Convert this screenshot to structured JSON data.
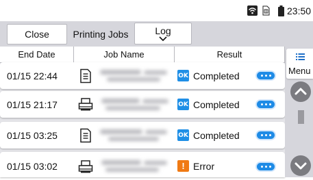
{
  "status_bar": {
    "time": "23:50"
  },
  "toolbar": {
    "close_label": "Close",
    "printing_jobs_label": "Printing Jobs",
    "log_label": "Log"
  },
  "table": {
    "columns": [
      "End Date",
      "Job Name",
      "Result"
    ],
    "rows": [
      {
        "end_date": "01/15 22:44",
        "job_icon": "document-icon",
        "result": "Completed",
        "result_icon": "ok-icon",
        "result_icon_text": "OK"
      },
      {
        "end_date": "01/15 21:17",
        "job_icon": "printer-icon",
        "result": "Completed",
        "result_icon": "ok-icon",
        "result_icon_text": "OK"
      },
      {
        "end_date": "01/15 03:25",
        "job_icon": "document-icon",
        "result": "Completed",
        "result_icon": "ok-icon",
        "result_icon_text": "OK"
      },
      {
        "end_date": "01/15 03:02",
        "job_icon": "printer-icon",
        "result": "Error",
        "result_icon": "error-icon",
        "result_icon_text": "!"
      }
    ]
  },
  "side": {
    "menu_label": "Menu"
  },
  "colors": {
    "accent_blue": "#1e8be6",
    "error_orange": "#f07a14",
    "toolbar_gray": "#d6d6dc"
  }
}
